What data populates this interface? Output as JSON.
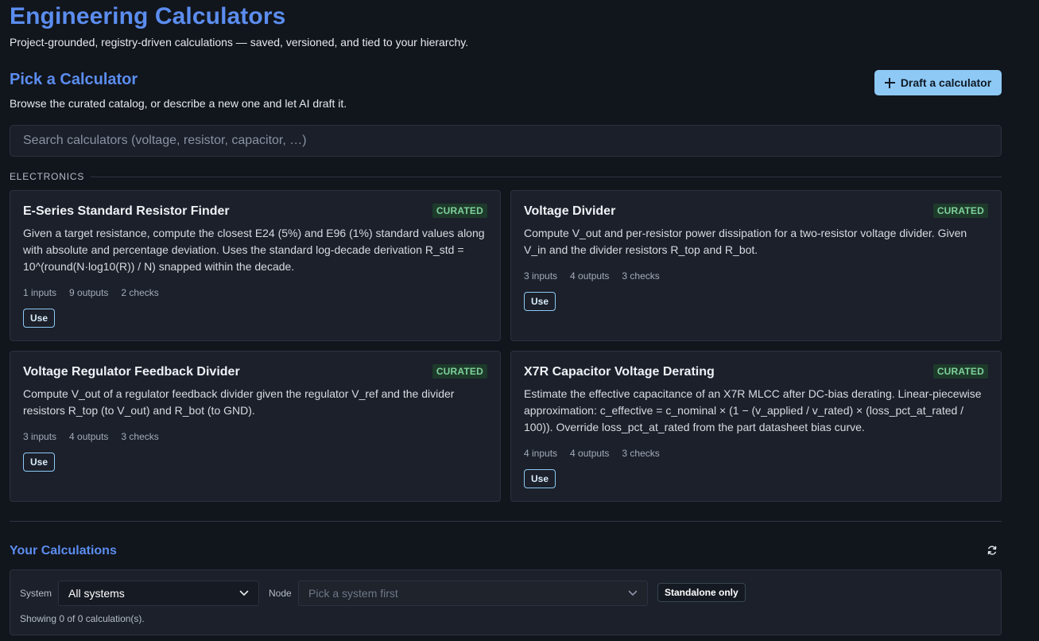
{
  "header": {
    "title": "Engineering Calculators",
    "subtitle": "Project-grounded, registry-driven calculations — saved, versioned, and tied to your hierarchy."
  },
  "picker": {
    "title": "Pick a Calculator",
    "subtitle": "Browse the curated catalog, or describe a new one and let AI draft it.",
    "draft_button_label": "Draft a calculator",
    "search_placeholder": "Search calculators (voltage, resistor, capacitor, …)",
    "group_label": "ELECTRONICS"
  },
  "cards": [
    {
      "title": "E-Series Standard Resistor Finder",
      "badge": "CURATED",
      "description": "Given a target resistance, compute the closest E24 (5%) and E96 (1%) standard values along with absolute and percentage deviation. Uses the standard log-decade derivation R_std = 10^(round(N·log10(R)) / N) snapped within the decade.",
      "inputs": "1 inputs",
      "outputs": "9 outputs",
      "checks": "2 checks",
      "use_label": "Use"
    },
    {
      "title": "Voltage Divider",
      "badge": "CURATED",
      "description": "Compute V_out and per-resistor power dissipation for a two-resistor voltage divider. Given V_in and the divider resistors R_top and R_bot.",
      "inputs": "3 inputs",
      "outputs": "4 outputs",
      "checks": "3 checks",
      "use_label": "Use"
    },
    {
      "title": "Voltage Regulator Feedback Divider",
      "badge": "CURATED",
      "description": "Compute V_out of a regulator feedback divider given the regulator V_ref and the divider resistors R_top (to V_out) and R_bot (to GND).",
      "inputs": "3 inputs",
      "outputs": "4 outputs",
      "checks": "3 checks",
      "use_label": "Use"
    },
    {
      "title": "X7R Capacitor Voltage Derating",
      "badge": "CURATED",
      "description": "Estimate the effective capacitance of an X7R MLCC after DC-bias derating. Linear-piecewise approximation: c_effective = c_nominal × (1 − (v_applied / v_rated) × (loss_pct_at_rated / 100)). Override loss_pct_at_rated from the part datasheet bias curve.",
      "inputs": "4 inputs",
      "outputs": "4 outputs",
      "checks": "3 checks",
      "use_label": "Use"
    }
  ],
  "calculations": {
    "title": "Your Calculations",
    "system_label": "System",
    "system_value": "All systems",
    "node_label": "Node",
    "node_placeholder": "Pick a system first",
    "standalone_label": "Standalone only",
    "showing_text": "Showing 0 of 0 calculation(s)."
  },
  "colors": {
    "background": "#11151c",
    "accent": "#5b8def",
    "primary_button": "#8ec9f5",
    "badge_text": "#7fd19b",
    "badge_bg": "#1d3a2a"
  },
  "icons": {
    "draft_button": "plus-icon",
    "refresh": "refresh-icon",
    "select": "chevron-down-icon"
  }
}
